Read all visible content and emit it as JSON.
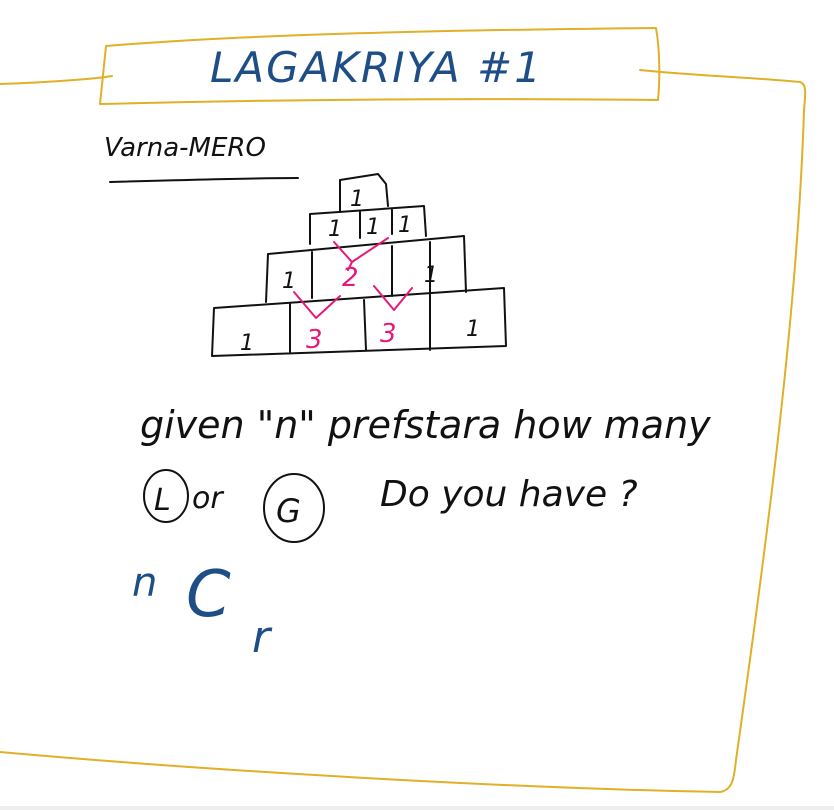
{
  "note": {
    "title": "LAGAKRIYA #1",
    "subtitle": "Varna-MERO",
    "question_line1": "given \"n\" prefstara how many",
    "question_line2": "or",
    "question_line3": "Do you have ?",
    "circled_left": "L",
    "circled_right": "G",
    "formula_n": "n",
    "formula_c": "C",
    "formula_r": "r"
  },
  "pyramid": {
    "top_row": [
      "1"
    ],
    "row2": [
      "1",
      "1",
      "1"
    ],
    "row3": [
      "1",
      "2",
      "1"
    ],
    "row4": [
      "1",
      "3",
      "3",
      "1"
    ]
  },
  "colors": {
    "title_ink": "#1e4e86",
    "black_ink": "#111111",
    "pink_ink": "#e6197a",
    "gold_border": "#e0b028",
    "formula_ink": "#1e4e86"
  }
}
